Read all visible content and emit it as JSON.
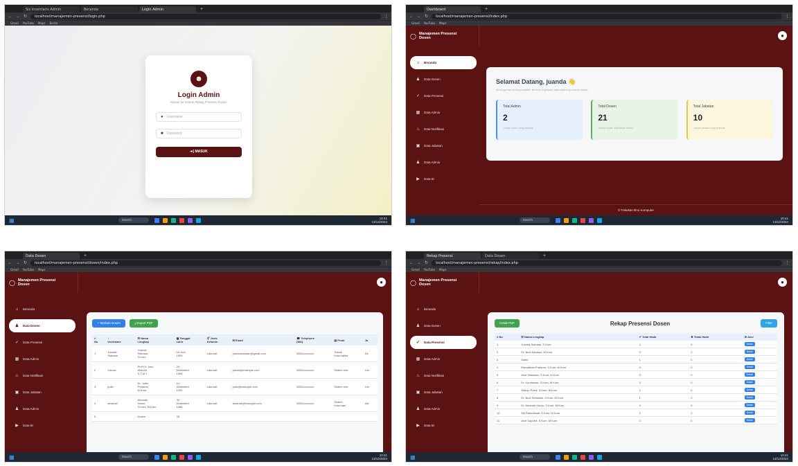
{
  "q1": {
    "tabs": [
      "Sis Inventaris Admin",
      "Beranda",
      "Login Admin"
    ],
    "url": "localhost/manajemen-presensi/login.php",
    "bookmarks": [
      "Gmail",
      "YouTube",
      "Maps",
      "Berita"
    ],
    "login": {
      "title": "Login Admin",
      "subtitle": "Masuk ke Sistem Rekap Presensi Dosen",
      "username_placeholder": "Username",
      "password_placeholder": "Password",
      "button_label": "➔] MASUK"
    }
  },
  "q2": {
    "tabs": [
      "Dashboard"
    ],
    "url": "localhost/manajemen-presensi/index.php",
    "welcome_title": "Selamat Datang, juanda 👋",
    "welcome_sub": "Semoga hari Anda produktif. Berikut ringkasan data sistem presensi dosen.",
    "stats": [
      {
        "label": "Total Admin",
        "value": "2",
        "desc": "Jumlah admin yang terdaftar"
      },
      {
        "label": "Total Dosen",
        "value": "21",
        "desc": "Jumlah dosen aktif dalam sistem"
      },
      {
        "label": "Total Jabatan",
        "value": "10",
        "desc": "Jumlah jabatan yang tersedia"
      }
    ],
    "footer": "© Fakultas Ilmu Komputer"
  },
  "q3": {
    "tabs": [
      "Data Dosen"
    ],
    "url": "localhost/manajemen-presensi/dosen/index.php",
    "add_button": "+ Tambah Dosen",
    "export_button": "⤓ Export PDF",
    "columns": [
      "#\nNo",
      "↓\nUsername",
      "☰ Nama\nLengkap",
      "▦ Tanggal\nLahir",
      "⚥ Jenis\nKelamin",
      "✉ Email",
      "☎ Telephone\n(WA)",
      "▤ Prodi",
      "Ja"
    ],
    "rows": [
      [
        "1",
        "Juanda\nSiahaan",
        "Juanda\nSiahaan,\nS.Kom",
        "04 Juni\n1993",
        "Laki-laki",
        "juandasiahaan@gmail.com",
        "0852xxxxxxxx",
        "Teknik\nInformatika",
        "De"
      ],
      [
        "2",
        "Jokowi",
        "Prof Dr. Joko\nWidodo,\nS.T M.T",
        "20\nDesember\n1985",
        "Laki-laki",
        "jokowi@example.com",
        "0852xxxxxxxx",
        "Sistem Info",
        "Lek"
      ],
      [
        "3",
        "judin",
        "Dr. Judin\nPratama,\nM.Kom",
        "14\nDesember\n1990",
        "Laki-laki",
        "judin@example.com",
        "0852xxxxxxxx",
        "Sistem Info",
        "Lek"
      ],
      [
        "4",
        "amanah",
        "Amanah\nHarun,\nS.Kom, M.Kom",
        "30\nDesember\n1988",
        "Laki-laki",
        "amanah@example.com",
        "0852xxxxxxxx",
        "Sistem\nInformasi",
        "Ast"
      ],
      [
        "5",
        "",
        "Dosen",
        "30",
        "",
        "",
        "",
        "",
        ""
      ]
    ]
  },
  "q4": {
    "tabs": [
      "Rekap Presensi",
      "Data Dosen"
    ],
    "url": "localhost/manajemen-presensi/rekap/index.php",
    "print_button": "Cetak PDF",
    "title": "Rekap Presensi Dosen",
    "filter_button": "Filter",
    "columns": [
      "# No",
      "☰ Nama Lengkap",
      "✔ Total Hadir",
      "✖ Tidak Hadir",
      "⚙ Aksi"
    ],
    "rows": [
      [
        "1",
        "Juanda Siahaan, S.Kom",
        "2",
        "0"
      ],
      [
        "2",
        "Dr. Budi Santoso, M.Kom",
        "0",
        "0"
      ],
      [
        "3",
        "Saiful",
        "1",
        "0"
      ],
      [
        "4",
        "Ramadhan Pratama, S.Kom, M.Kom",
        "0",
        "0"
      ],
      [
        "5",
        "Andi Setiawan, S.Kom, M.Kom",
        "2",
        "0"
      ],
      [
        "6",
        "Dr. Kurniawan, S.Kom, M.Kom",
        "3",
        "0"
      ],
      [
        "7",
        "Wahyu Putra, S.Kom, M.Kom",
        "2",
        "0"
      ],
      [
        "8",
        "Dr. Budi Setiawan, S.Kom, M.Kom",
        "1",
        "0"
      ],
      [
        "9",
        "Dr. Amanah Harun, S.Kom, M.Kom",
        "0",
        "0"
      ],
      [
        "10",
        "Siti Rahmawati, S.Kom, M.Kom",
        "2",
        "0"
      ],
      [
        "11",
        "Andi Saputra, S.Kom, M.Kom",
        "0",
        "0"
      ]
    ],
    "detail_label": "Detail"
  },
  "app": {
    "brand": "Manajemen Presensi\nDosen",
    "nav": [
      "Beranda",
      "Data Dosen",
      "Data Presensi",
      "Data Admin",
      "Data Notifikasi",
      "Data Jabatan",
      "Data Admin",
      "Data Bi"
    ]
  },
  "taskbar": {
    "search": "Search",
    "clock": "10:41\n13/12/2024"
  }
}
